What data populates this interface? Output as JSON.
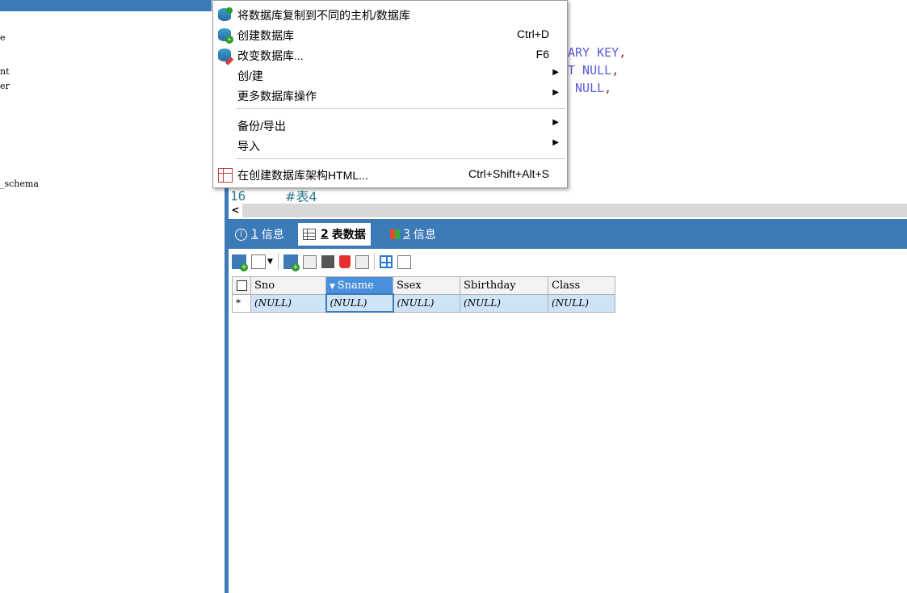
{
  "left_tree": {
    "items": [
      "e",
      "nt",
      "er",
      "_schema"
    ]
  },
  "editor": {
    "code_lines": [
      {
        "text": "ARY KEY",
        "punct": ","
      },
      {
        "text": "T NULL",
        "punct": ","
      },
      {
        "text": " NULL",
        "punct": ","
      }
    ],
    "line_number": "16",
    "line_code": "#表4",
    "scroll_left_arrow": "<"
  },
  "tabs": [
    {
      "num": "1",
      "label": "信息"
    },
    {
      "num": "2",
      "label": "表数据"
    },
    {
      "num": "3",
      "label": "信息"
    }
  ],
  "info_glyph": "i",
  "toolbar": {
    "icons": [
      "add-row-icon",
      "grid-options-icon",
      "insert-row-icon",
      "duplicate-row-icon",
      "save-icon",
      "delete-icon",
      "discard-icon",
      "grid-view-icon",
      "form-view-icon"
    ]
  },
  "grid": {
    "columns": [
      "Sno",
      "Sname",
      "Ssex",
      "Sbirthday",
      "Class"
    ],
    "sorted_column": "Sname",
    "row_marker": "*",
    "row": [
      "(NULL)",
      "(NULL)",
      "(NULL)",
      "(NULL)",
      "(NULL)"
    ]
  },
  "context_menu": {
    "items": [
      {
        "label": "将数据库复制到不同的主机/数据库",
        "shortcut": "",
        "icon": "database-copy-icon"
      },
      {
        "label": "创建数据库",
        "shortcut": "Ctrl+D",
        "icon": "database-create-icon"
      },
      {
        "label": "改变数据库...",
        "shortcut": "F6",
        "icon": "database-alter-icon"
      },
      {
        "label": "创/建",
        "submenu": true
      },
      {
        "label": "更多数据库操作",
        "submenu": true
      },
      {
        "label": "备份/导出",
        "submenu": true
      },
      {
        "label": "导入",
        "submenu": true
      },
      {
        "label": "在创建数据库架构HTML...",
        "shortcut": "Ctrl+Shift+Alt+S",
        "icon": "html-schema-icon"
      }
    ],
    "submenu_arrow": "▶"
  },
  "colors": {
    "accent": "#3d7ab8",
    "code_keyword": "#5b58d8",
    "comment": "#2f7a8a",
    "row_bg": "#cfe3f7"
  }
}
